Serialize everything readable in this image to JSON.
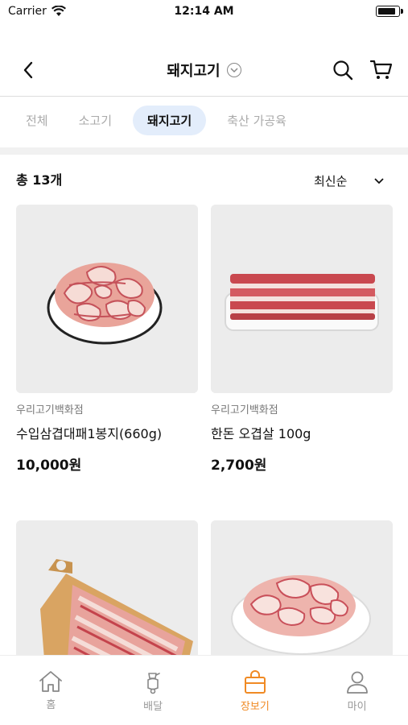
{
  "status_bar": {
    "carrier": "Carrier",
    "time": "12:14 AM"
  },
  "header": {
    "title": "돼지고기"
  },
  "tabs": [
    {
      "label": "전체",
      "active": false
    },
    {
      "label": "소고기",
      "active": false
    },
    {
      "label": "돼지고기",
      "active": true
    },
    {
      "label": "축산 가공육",
      "active": false
    }
  ],
  "list": {
    "count_text": "총 13개",
    "sort_label": "최신순"
  },
  "products": [
    {
      "seller": "우리고기백화점",
      "name": "수입삼겹대패1봉지(660g)",
      "price": "10,000원",
      "image": "plate-sliced-pork"
    },
    {
      "seller": "우리고기백화점",
      "name": "한돈 오겹살 100g",
      "price": "2,700원",
      "image": "tray-pork-belly"
    },
    {
      "seller": "",
      "name": "",
      "price": "",
      "image": "cutting-board-pork"
    },
    {
      "seller": "",
      "name": "",
      "price": "",
      "image": "plate-pork-slices"
    }
  ],
  "bottom_nav": [
    {
      "label": "홈",
      "icon": "home-icon",
      "active": false
    },
    {
      "label": "배달",
      "icon": "scooter-icon",
      "active": false
    },
    {
      "label": "장보기",
      "icon": "shopping-bag-icon",
      "active": true
    },
    {
      "label": "마이",
      "icon": "user-icon",
      "active": false
    }
  ],
  "colors": {
    "accent": "#f08a24",
    "tab_active_bg": "#e3edfb",
    "band": "#f1f1f1"
  }
}
